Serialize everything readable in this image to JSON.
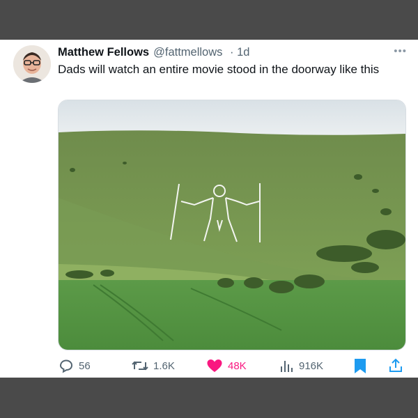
{
  "tweet": {
    "author_name": "Matthew Fellows",
    "author_handle": "@fattmellows",
    "timestamp": "· 1d",
    "more_label": "•••",
    "text": "Dads will watch an entire movie stood in the doorway like this"
  },
  "media": {
    "description_icon": "photo-long-man-hill-figure"
  },
  "actions": {
    "replies": "56",
    "reposts": "1.6K",
    "likes": "48K",
    "views": "916K"
  },
  "colors": {
    "like": "#f91880",
    "bookmark": "#1d9bf0",
    "share": "#1d9bf0",
    "muted": "#536471"
  }
}
